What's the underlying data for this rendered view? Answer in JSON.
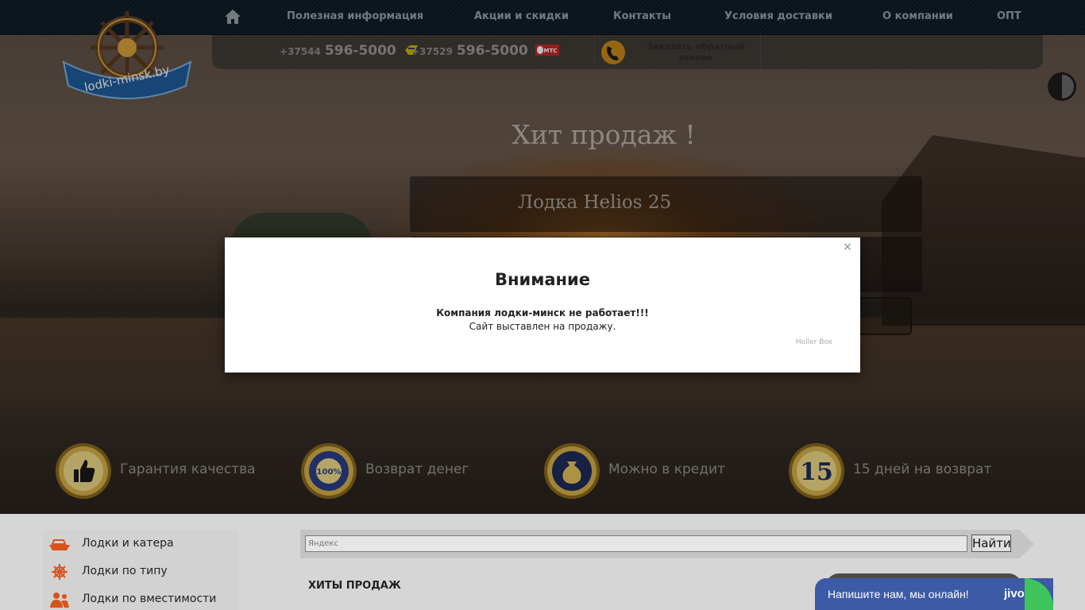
{
  "nav": {
    "home_icon": "home-icon",
    "items": [
      {
        "label": "Полезная информация"
      },
      {
        "label": "Акции и скидки"
      },
      {
        "label": "Контакты"
      },
      {
        "label": "Условия доставки"
      },
      {
        "label": "О компании"
      },
      {
        "label": "ОПТ"
      }
    ]
  },
  "logo": {
    "text": "lodki-minsk.by"
  },
  "phones": [
    {
      "code": "+37544",
      "number": "596-5000",
      "operator_icon": "velcom-icon"
    },
    {
      "code": "+37529",
      "number": "596-5000",
      "operator_icon": "mts-icon",
      "operator_label": "МТС"
    }
  ],
  "callback": {
    "label": "Заказать обратный звонок",
    "icon": "phone-handset-icon"
  },
  "hero": {
    "title": "Хит продаж !",
    "product": "Лодка Helios 25"
  },
  "benefits": [
    {
      "label": "Гарантия качества",
      "icon": "thumbs-up-medal-icon"
    },
    {
      "label": "Возврат денег",
      "icon": "money-back-medal-icon",
      "badge_text": "100%"
    },
    {
      "label": "Можно в кредит",
      "icon": "money-bag-medal-icon"
    },
    {
      "label": "15 дней на возврат",
      "icon": "fifteen-days-medal-icon",
      "badge_text": "15"
    }
  ],
  "sidebar": {
    "items": [
      {
        "label": "Лодки и катера",
        "icon": "boat-icon"
      },
      {
        "label": "Лодки по типу",
        "icon": "helm-icon"
      },
      {
        "label": "Лодки по вместимости",
        "icon": "people-icon"
      }
    ]
  },
  "search": {
    "placeholder": "Яндекс",
    "button_label": "Найти"
  },
  "hits": {
    "title": "ХИТЫ ПРОДАЖ"
  },
  "modal": {
    "close_label": "×",
    "title": "Внимание",
    "line1": "Компания лодки-минск не работает!!!",
    "line2": "Сайт выставлен на продажу.",
    "credit": "Holler Box"
  },
  "chat": {
    "text": "Напишите нам, мы онлайн!",
    "brand": "jivo"
  },
  "colors": {
    "nav_bg": "#15222c",
    "modal_bg": "#ffffff",
    "chat_bg": "#3c5aa6",
    "chat_online": "#3ec45a",
    "medal_gold": "#c9a640"
  }
}
